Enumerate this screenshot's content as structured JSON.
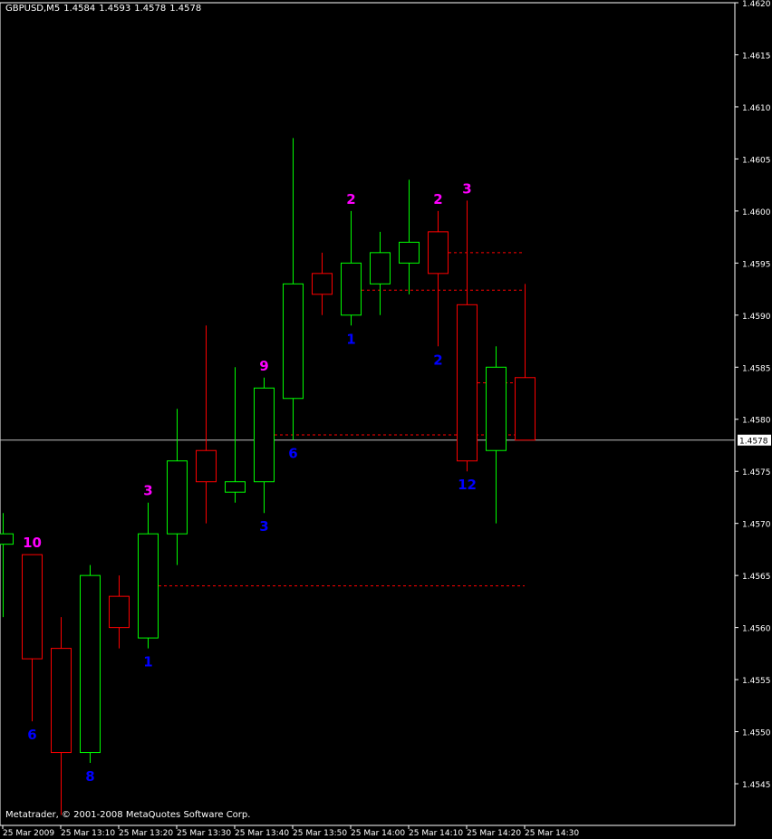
{
  "header": {
    "symbol": "GBPUSD,M5",
    "ohlc": [
      "1.4584",
      "1.4593",
      "1.4578",
      "1.4578"
    ]
  },
  "copyright": "Metatrader, © 2001-2008 MetaQuotes Software Corp.",
  "colors": {
    "background": "#000000",
    "up": "#00ff00",
    "down": "#ff0000",
    "upper_count": "#ff00ff",
    "lower_count": "#0000ff",
    "axis": "#ffffff",
    "level": "#ff0000",
    "current_line": "#c0c0c0"
  },
  "chart_data": {
    "type": "candlestick",
    "x_labels": [
      "25 Mar 2009",
      "25 Mar 13:10",
      "25 Mar 13:20",
      "25 Mar 13:30",
      "25 Mar 13:40",
      "25 Mar 13:50",
      "25 Mar 14:00",
      "25 Mar 14:10",
      "25 Mar 14:20",
      "25 Mar 14:30"
    ],
    "x_label_bar_index": [
      0,
      2,
      4,
      6,
      8,
      10,
      12,
      14,
      16,
      18
    ],
    "y_ticks": [
      "1.4620",
      "1.4615",
      "1.4610",
      "1.4605",
      "1.4600",
      "1.4595",
      "1.4590",
      "1.4585",
      "1.4580",
      "1.4575",
      "1.4570",
      "1.4565",
      "1.4560",
      "1.4555",
      "1.4550",
      "1.4545"
    ],
    "ylim": [
      1.4541,
      1.462
    ],
    "current_price": "1.4578",
    "candles": [
      {
        "open": 1.4568,
        "high": 1.4571,
        "low": 1.4561,
        "close": 1.4569
      },
      {
        "open": 1.4567,
        "high": 1.4567,
        "low": 1.4551,
        "close": 1.4557
      },
      {
        "open": 1.4558,
        "high": 1.4561,
        "low": 1.4542,
        "close": 1.4548
      },
      {
        "open": 1.4548,
        "high": 1.4566,
        "low": 1.4547,
        "close": 1.4565
      },
      {
        "open": 1.4563,
        "high": 1.4565,
        "low": 1.4558,
        "close": 1.456
      },
      {
        "open": 1.4559,
        "high": 1.4572,
        "low": 1.4558,
        "close": 1.4569
      },
      {
        "open": 1.4569,
        "high": 1.4581,
        "low": 1.4566,
        "close": 1.4576
      },
      {
        "open": 1.4577,
        "high": 1.4589,
        "low": 1.457,
        "close": 1.4574
      },
      {
        "open": 1.4573,
        "high": 1.4585,
        "low": 1.4572,
        "close": 1.4574
      },
      {
        "open": 1.4574,
        "high": 1.4584,
        "low": 1.4571,
        "close": 1.4583
      },
      {
        "open": 1.4582,
        "high": 1.4607,
        "low": 1.4578,
        "close": 1.4593
      },
      {
        "open": 1.4594,
        "high": 1.4596,
        "low": 1.459,
        "close": 1.4592
      },
      {
        "open": 1.459,
        "high": 1.46,
        "low": 1.4589,
        "close": 1.4595
      },
      {
        "open": 1.4593,
        "high": 1.4598,
        "low": 1.459,
        "close": 1.4596
      },
      {
        "open": 1.4595,
        "high": 1.4603,
        "low": 1.4592,
        "close": 1.4597
      },
      {
        "open": 1.4598,
        "high": 1.46,
        "low": 1.4587,
        "close": 1.4594
      },
      {
        "open": 1.4591,
        "high": 1.4601,
        "low": 1.4575,
        "close": 1.4576
      },
      {
        "open": 1.4577,
        "high": 1.4587,
        "low": 1.457,
        "close": 1.4585
      },
      {
        "open": 1.4584,
        "high": 1.4593,
        "low": 1.4578,
        "close": 1.4578
      }
    ],
    "upper_labels": [
      {
        "bar": 1,
        "text": "10",
        "price": 1.4567
      },
      {
        "bar": 5,
        "text": "3",
        "price": 1.4572
      },
      {
        "bar": 9,
        "text": "9",
        "price": 1.4584
      },
      {
        "bar": 12,
        "text": "2",
        "price": 1.46
      },
      {
        "bar": 15,
        "text": "2",
        "price": 1.46
      },
      {
        "bar": 16,
        "text": "3",
        "price": 1.4601
      }
    ],
    "lower_labels": [
      {
        "bar": 1,
        "text": "6",
        "price": 1.4551
      },
      {
        "bar": 3,
        "text": "8",
        "price": 1.4547
      },
      {
        "bar": 5,
        "text": "1",
        "price": 1.4558
      },
      {
        "bar": 9,
        "text": "3",
        "price": 1.4571
      },
      {
        "bar": 10,
        "text": "6",
        "price": 1.4578
      },
      {
        "bar": 12,
        "text": "1",
        "price": 1.4589
      },
      {
        "bar": 15,
        "text": "2",
        "price": 1.4587
      },
      {
        "bar": 16,
        "text": "12",
        "price": 1.4575
      }
    ],
    "levels": [
      {
        "price": 1.4564,
        "from_bar": 5,
        "to_bar": 18
      },
      {
        "price": 1.45785,
        "from_bar": 9,
        "to_bar": 18
      },
      {
        "price": 1.45924,
        "from_bar": 12,
        "to_bar": 18
      },
      {
        "price": 1.4596,
        "from_bar": 15,
        "to_bar": 18
      },
      {
        "price": 1.45835,
        "from_bar": 16,
        "to_bar": 18
      }
    ]
  }
}
